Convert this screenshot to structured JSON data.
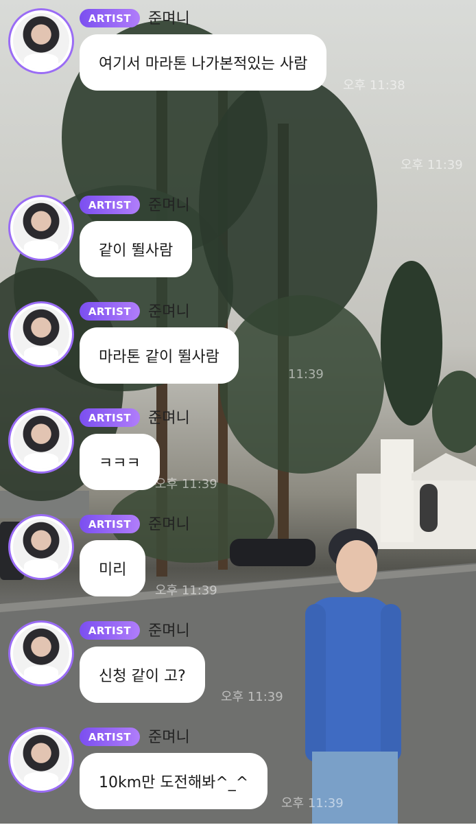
{
  "chat": {
    "messages": [
      {
        "badge": "ARTIST",
        "sender": "준며니",
        "text": "여기서 마라톤 나가본적있는 사람",
        "time": "오후 11:38"
      },
      {
        "badge": "ARTIST",
        "sender": "준며니",
        "text": "같이 뛸사람",
        "time": "오후 11:39"
      },
      {
        "badge": "ARTIST",
        "sender": "준며니",
        "text": "마라톤 같이 뛸사람",
        "time": "11:39"
      },
      {
        "badge": "ARTIST",
        "sender": "준며니",
        "text": "ㅋㅋㅋ",
        "time": "오후 11:39"
      },
      {
        "badge": "ARTIST",
        "sender": "준며니",
        "text": "미리",
        "time": "오후 11:39"
      },
      {
        "badge": "ARTIST",
        "sender": "준며니",
        "text": "신청 같이 고?",
        "time": "오후 11:39"
      },
      {
        "badge": "ARTIST",
        "sender": "준며니",
        "text": "10km만 도전해봐^_^",
        "time": "오후 11:39"
      }
    ]
  },
  "colors": {
    "badge_start": "#7b4ff0",
    "badge_end": "#b07dfa",
    "bubble": "#ffffff",
    "avatar_ring": "#9a6cf5"
  }
}
